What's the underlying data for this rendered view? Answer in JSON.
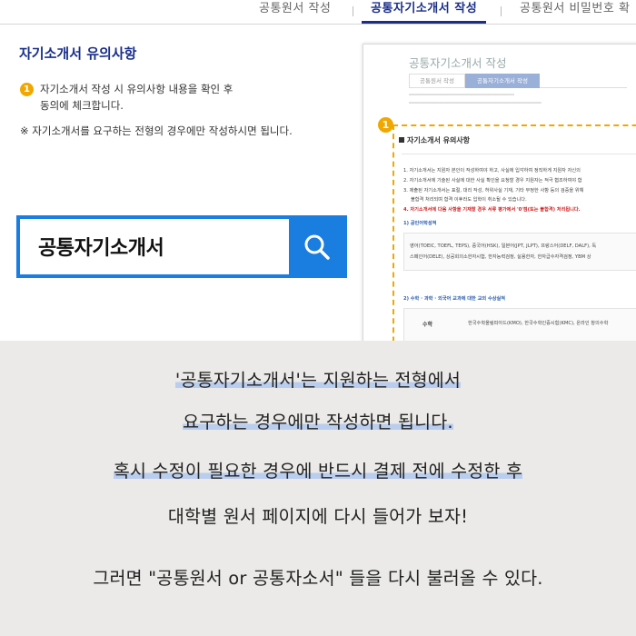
{
  "tabs": [
    {
      "label": "공통원서 작성"
    },
    {
      "label": "공통자기소개서 작성"
    },
    {
      "label": "공통원서 비밀번호 확"
    }
  ],
  "notice": {
    "title": "자기소개서 유의사항",
    "badge": "1",
    "line1": "자기소개서 작성 시 유의사항 내용을 확인 후",
    "line2": "동의에 체크합니다.",
    "note": "※ 자기소개서를 요구하는 전형의 경우에만 작성하시면 됩니다."
  },
  "search": {
    "text": "공통자기소개서",
    "icon": "search-icon"
  },
  "doc": {
    "title": "공통자기소개서 작성",
    "tab1": "공통원서 작성",
    "tab2": "공통자기소개서 작성",
    "badge": "1",
    "section": "자기소개서 유의사항",
    "item1": "1. 자기소개서는 지원자 본인이 작성하여야 하고, 사실에 입각하여 정직하게 지원자 자신의",
    "item2": "2. 자기소개서에 기술된 사실에 대한 사실 확인을 요청할 경우 지원자는 적극 협조하여야 합",
    "item3": "3. 제출된 자기소개서는 표절, 대리 작성, 허위사실 기재, 기타 부정한 사항 등의 검증을 위해",
    "item3b": "불합격 처리되며 합격 이후라도 입학이 취소될 수 있습니다.",
    "item4": "4. 자기소개서에 다음 사항을 기재할 경우 서류 평가에서 '0'점(또는 불합격) 처리됩니다.",
    "sub1": "1) 공인어학성적",
    "langs1": "영어(TOEIC, TOEFL, TEPS), 중국어(HSK), 일본어(JPT, JLPT), 프랑스어(DELF, DALF), 독",
    "langs2": "스페인어(DELE), 상공회의소한자시험, 한자능력검정, 실용한자, 한자급수자격검정, YBM 상",
    "sub2": "2) 수학 · 과학 · 외국어 교과에 대한 교외 수상실적",
    "row_label": "수학",
    "row_value": "한국수학올림피아드(KMO), 한국수학인증시험(KMC), 온라인 창의수학"
  },
  "captions": {
    "line1": "'공통자기소개서'는 지원하는 전형에서",
    "line2": "요구하는 경우에만 작성하면 됩니다.",
    "line3": "혹시 수정이 필요한 경우에 반드시 결제 전에 수정한 후",
    "line4": "대학별 원서 페이지에 다시 들어가 보자!",
    "line5": "그러면 \"공통원서 or 공통자소서\" 들을 다시 불러올 수 있다."
  },
  "colors": {
    "accent": "#1a2f8a",
    "search_blue": "#1a7de0",
    "badge": "#f0a800",
    "highlight": "#b9cdee"
  }
}
